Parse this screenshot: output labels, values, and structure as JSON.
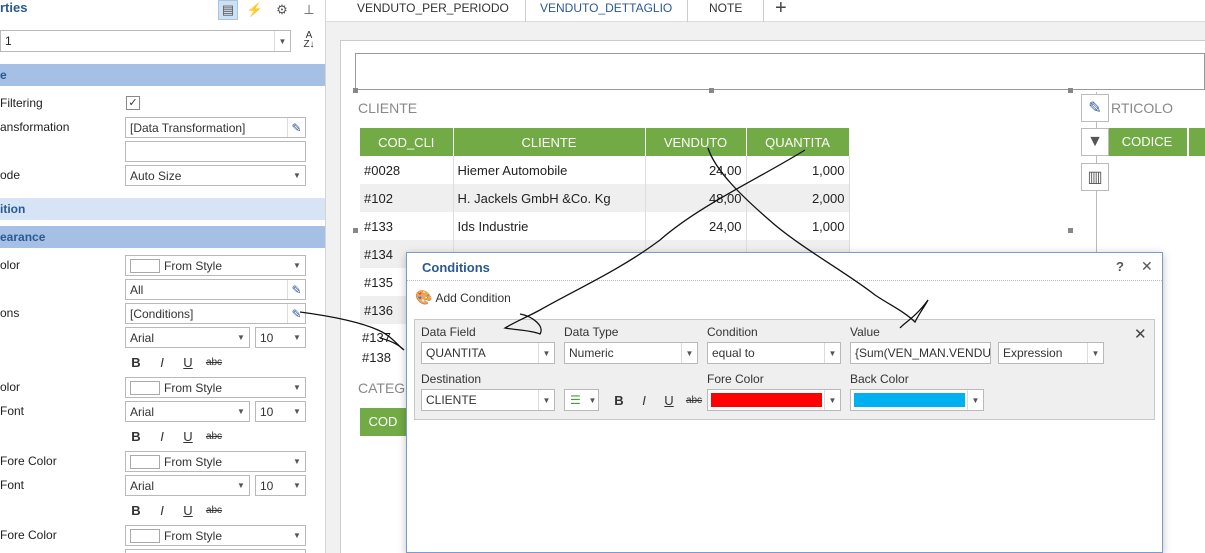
{
  "properties": {
    "title": "rties",
    "combo_value": "1",
    "sections": {
      "first": "e",
      "second": "ition",
      "appearance": "earance"
    },
    "rows": {
      "filtering_label": "Filtering",
      "transformation_label": "ansformation",
      "transformation_value": "[Data Transformation]",
      "mode_label": "ode",
      "mode_value": "Auto Size",
      "color_label": "olor",
      "color_value": "From Style",
      "all_value": "All",
      "conditions_label": "ons",
      "conditions_value": "[Conditions]",
      "font1_value": "Arial",
      "size1_value": "10",
      "color2_label": "olor",
      "color2_value": "From Style",
      "font2_label": "Font",
      "font2_value": "Arial",
      "size2_value": "10",
      "forecolor1_label": "Fore Color",
      "forecolor1_value": "From Style",
      "font3_label": "Font",
      "font3_value": "Arial",
      "size3_value": "10",
      "forecolor2_label": "Fore Color",
      "forecolor2_value": "From Style"
    },
    "format": {
      "bold": "B",
      "italic": "I",
      "underline": "U",
      "strike": "abc"
    }
  },
  "tabs": [
    {
      "label": "VENDUTO_PER_PERIODO"
    },
    {
      "label": "VENDUTO_DETTAGLIO"
    },
    {
      "label": "NOTE"
    }
  ],
  "tab_add": "+",
  "report": {
    "cliente_label": "CLIENTE",
    "articolo_label": "RTICOLO",
    "categ_label": "CATEG",
    "headers": [
      "COD_CLI",
      "CLIENTE",
      "VENDUTO",
      "QUANTITA"
    ],
    "rows": [
      [
        "#0028",
        "Hiemer Automobile",
        "24,00",
        "1,000"
      ],
      [
        "#102",
        "H. Jackels GmbH &Co. Kg",
        "48,00",
        "2,000"
      ],
      [
        "#133",
        "Ids Industrie",
        "24,00",
        "1,000"
      ],
      [
        "#134",
        "",
        "",
        ""
      ],
      [
        "#135",
        "",
        "",
        ""
      ],
      [
        "#136",
        "",
        "",
        ""
      ],
      [
        "#137",
        "",
        "",
        ""
      ],
      [
        "#138",
        "",
        "",
        ""
      ]
    ],
    "codice_header": "CODICE",
    "cod_header_cut": "COD"
  },
  "dialog": {
    "title": "Conditions",
    "help": "?",
    "close": "✕",
    "add_condition": "Add Condition",
    "labels": {
      "data_field": "Data Field",
      "data_type": "Data Type",
      "condition": "Condition",
      "value": "Value",
      "destination": "Destination",
      "fore_color": "Fore Color",
      "back_color": "Back Color"
    },
    "values": {
      "data_field": "QUANTITA",
      "data_type": "Numeric",
      "condition": "equal to",
      "value": "{Sum(VEN_MAN.VENDU",
      "value_type": "Expression",
      "destination": "CLIENTE"
    },
    "colors": {
      "fore": "#ff0000",
      "back": "#00b0f0"
    },
    "remove": "✕",
    "format": {
      "bold": "B",
      "italic": "I",
      "underline": "U",
      "strike": "abc"
    }
  },
  "colors": {
    "accent_blue": "#2a5a93",
    "header_green": "#72ab45",
    "section_blue": "#a5c0e4"
  }
}
